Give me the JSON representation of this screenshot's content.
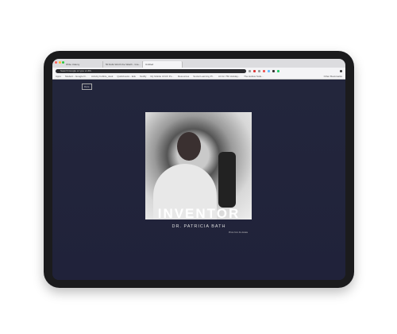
{
  "browser": {
    "tabs": [
      {
        "label": "Write Udemy"
      },
      {
        "label": "50 Dolls Worth the Watch - Gre..."
      },
      {
        "label": "Untitled"
      }
    ],
    "address_placeholder": "Search Google or type a URL",
    "bookmarks": [
      "Apps",
      "Student - Google D...",
      "Activity bubble_desk",
      "Quickbooks - Edu",
      "Netlify",
      "My Mobile UI/UX Po...",
      "Resources",
      "Social Learning Pl...",
      "Art for 750 Holiday...",
      "The Hollow Sofa...",
      "Other Bookmarks"
    ],
    "window_colors": [
      "#ff5f57",
      "#febc2e",
      "#28c840"
    ]
  },
  "page": {
    "logo": "Dare",
    "headline": "INVENTOR",
    "subtitle": "DR. PATRICIA BATH",
    "credit": "Photo from the Estate"
  }
}
